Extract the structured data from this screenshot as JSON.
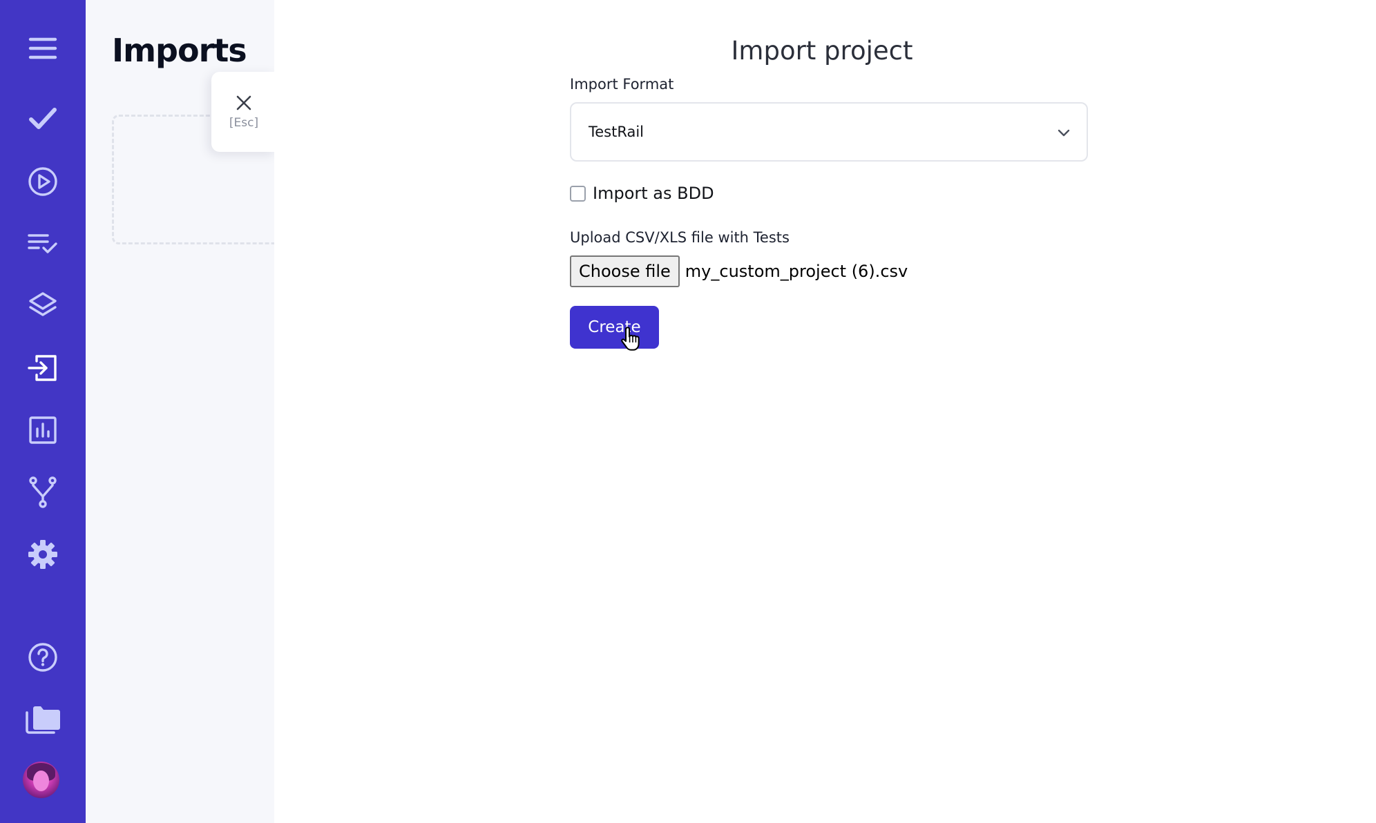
{
  "sidebar": {
    "items": [
      {
        "name": "menu",
        "icon": "hamburger-menu-icon"
      },
      {
        "name": "tests",
        "icon": "checkmark-icon"
      },
      {
        "name": "runs",
        "icon": "play-circle-icon"
      },
      {
        "name": "plans",
        "icon": "checklist-icon"
      },
      {
        "name": "steps",
        "icon": "layers-icon"
      },
      {
        "name": "imports",
        "icon": "import-icon",
        "active": true
      },
      {
        "name": "analytics",
        "icon": "bar-chart-icon"
      },
      {
        "name": "branches",
        "icon": "branch-icon"
      },
      {
        "name": "settings",
        "icon": "gear-icon"
      },
      {
        "name": "help",
        "icon": "help-circle-icon"
      },
      {
        "name": "projects",
        "icon": "folders-icon"
      }
    ],
    "avatar": "user-avatar"
  },
  "page": {
    "title": "Imports"
  },
  "close_tab": {
    "esc_label": "[Esc]"
  },
  "modal": {
    "title": "Import project",
    "format_label": "Import Format",
    "format_value": "TestRail",
    "bdd_label": "Import as BDD",
    "bdd_checked": false,
    "upload_label": "Upload CSV/XLS file with Tests",
    "choose_file_label": "Choose file",
    "file_name": "my_custom_project (6).csv",
    "create_label": "Create"
  },
  "colors": {
    "sidebar": "#4236c5",
    "primary_button": "#3f33cf",
    "icon": "#c9cdfb",
    "panel_bg": "#f6f7fb"
  }
}
